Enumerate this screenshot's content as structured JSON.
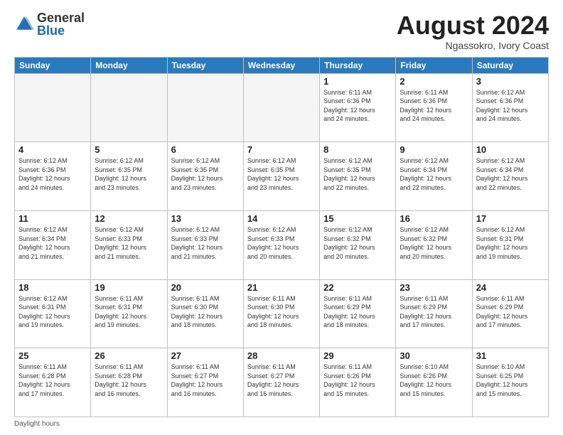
{
  "logo": {
    "general": "General",
    "blue": "Blue"
  },
  "header": {
    "month_year": "August 2024",
    "location": "Ngassokro, Ivory Coast"
  },
  "weekdays": [
    "Sunday",
    "Monday",
    "Tuesday",
    "Wednesday",
    "Thursday",
    "Friday",
    "Saturday"
  ],
  "weeks": [
    [
      {
        "day": "",
        "info": ""
      },
      {
        "day": "",
        "info": ""
      },
      {
        "day": "",
        "info": ""
      },
      {
        "day": "",
        "info": ""
      },
      {
        "day": "1",
        "info": "Sunrise: 6:11 AM\nSunset: 6:36 PM\nDaylight: 12 hours\nand 24 minutes."
      },
      {
        "day": "2",
        "info": "Sunrise: 6:11 AM\nSunset: 6:36 PM\nDaylight: 12 hours\nand 24 minutes."
      },
      {
        "day": "3",
        "info": "Sunrise: 6:12 AM\nSunset: 6:36 PM\nDaylight: 12 hours\nand 24 minutes."
      }
    ],
    [
      {
        "day": "4",
        "info": "Sunrise: 6:12 AM\nSunset: 6:36 PM\nDaylight: 12 hours\nand 24 minutes."
      },
      {
        "day": "5",
        "info": "Sunrise: 6:12 AM\nSunset: 6:35 PM\nDaylight: 12 hours\nand 23 minutes."
      },
      {
        "day": "6",
        "info": "Sunrise: 6:12 AM\nSunset: 6:35 PM\nDaylight: 12 hours\nand 23 minutes."
      },
      {
        "day": "7",
        "info": "Sunrise: 6:12 AM\nSunset: 6:35 PM\nDaylight: 12 hours\nand 23 minutes."
      },
      {
        "day": "8",
        "info": "Sunrise: 6:12 AM\nSunset: 6:35 PM\nDaylight: 12 hours\nand 22 minutes."
      },
      {
        "day": "9",
        "info": "Sunrise: 6:12 AM\nSunset: 6:34 PM\nDaylight: 12 hours\nand 22 minutes."
      },
      {
        "day": "10",
        "info": "Sunrise: 6:12 AM\nSunset: 6:34 PM\nDaylight: 12 hours\nand 22 minutes."
      }
    ],
    [
      {
        "day": "11",
        "info": "Sunrise: 6:12 AM\nSunset: 6:34 PM\nDaylight: 12 hours\nand 21 minutes."
      },
      {
        "day": "12",
        "info": "Sunrise: 6:12 AM\nSunset: 6:33 PM\nDaylight: 12 hours\nand 21 minutes."
      },
      {
        "day": "13",
        "info": "Sunrise: 6:12 AM\nSunset: 6:33 PM\nDaylight: 12 hours\nand 21 minutes."
      },
      {
        "day": "14",
        "info": "Sunrise: 6:12 AM\nSunset: 6:33 PM\nDaylight: 12 hours\nand 20 minutes."
      },
      {
        "day": "15",
        "info": "Sunrise: 6:12 AM\nSunset: 6:32 PM\nDaylight: 12 hours\nand 20 minutes."
      },
      {
        "day": "16",
        "info": "Sunrise: 6:12 AM\nSunset: 6:32 PM\nDaylight: 12 hours\nand 20 minutes."
      },
      {
        "day": "17",
        "info": "Sunrise: 6:12 AM\nSunset: 6:31 PM\nDaylight: 12 hours\nand 19 minutes."
      }
    ],
    [
      {
        "day": "18",
        "info": "Sunrise: 6:12 AM\nSunset: 6:31 PM\nDaylight: 12 hours\nand 19 minutes."
      },
      {
        "day": "19",
        "info": "Sunrise: 6:11 AM\nSunset: 6:31 PM\nDaylight: 12 hours\nand 19 minutes."
      },
      {
        "day": "20",
        "info": "Sunrise: 6:11 AM\nSunset: 6:30 PM\nDaylight: 12 hours\nand 18 minutes."
      },
      {
        "day": "21",
        "info": "Sunrise: 6:11 AM\nSunset: 6:30 PM\nDaylight: 12 hours\nand 18 minutes."
      },
      {
        "day": "22",
        "info": "Sunrise: 6:11 AM\nSunset: 6:29 PM\nDaylight: 12 hours\nand 18 minutes."
      },
      {
        "day": "23",
        "info": "Sunrise: 6:11 AM\nSunset: 6:29 PM\nDaylight: 12 hours\nand 17 minutes."
      },
      {
        "day": "24",
        "info": "Sunrise: 6:11 AM\nSunset: 6:29 PM\nDaylight: 12 hours\nand 17 minutes."
      }
    ],
    [
      {
        "day": "25",
        "info": "Sunrise: 6:11 AM\nSunset: 6:28 PM\nDaylight: 12 hours\nand 17 minutes."
      },
      {
        "day": "26",
        "info": "Sunrise: 6:11 AM\nSunset: 6:28 PM\nDaylight: 12 hours\nand 16 minutes."
      },
      {
        "day": "27",
        "info": "Sunrise: 6:11 AM\nSunset: 6:27 PM\nDaylight: 12 hours\nand 16 minutes."
      },
      {
        "day": "28",
        "info": "Sunrise: 6:11 AM\nSunset: 6:27 PM\nDaylight: 12 hours\nand 16 minutes."
      },
      {
        "day": "29",
        "info": "Sunrise: 6:11 AM\nSunset: 6:26 PM\nDaylight: 12 hours\nand 15 minutes."
      },
      {
        "day": "30",
        "info": "Sunrise: 6:10 AM\nSunset: 6:26 PM\nDaylight: 12 hours\nand 15 minutes."
      },
      {
        "day": "31",
        "info": "Sunrise: 6:10 AM\nSunset: 6:25 PM\nDaylight: 12 hours\nand 15 minutes."
      }
    ]
  ],
  "footer": {
    "daylight_label": "Daylight hours"
  }
}
